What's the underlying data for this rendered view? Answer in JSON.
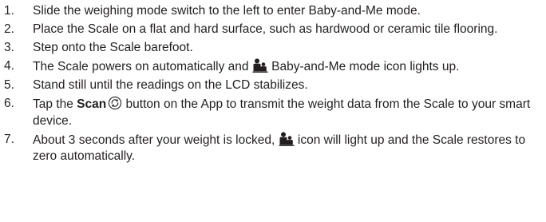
{
  "steps": [
    {
      "number": "1.",
      "text": "Slide the weighing mode switch to the left to enter Baby-and-Me mode."
    },
    {
      "number": "2.",
      "text": "Place the Scale on a flat and hard surface, such as hardwood or ceramic tile flooring."
    },
    {
      "number": "3.",
      "text": "Step onto the Scale barefoot."
    },
    {
      "number": "4.",
      "text_before": "The Scale powers on automatically and",
      "icon": "baby-and-me-icon",
      "text_after": "Baby-and-Me mode icon lights up."
    },
    {
      "number": "5.",
      "text": "Stand still until the readings on the LCD stabilizes."
    },
    {
      "number": "6.",
      "text_before": "Tap the",
      "bold": "Scan",
      "icon": "scan-icon",
      "text_after": "button on the App to transmit the weight data from the Scale to your smart device."
    },
    {
      "number": "7.",
      "text_before": "About 3 seconds after your weight is locked,",
      "icon": "baby-and-me-icon",
      "text_after": "icon will light up and the Scale restores to zero automatically."
    }
  ]
}
